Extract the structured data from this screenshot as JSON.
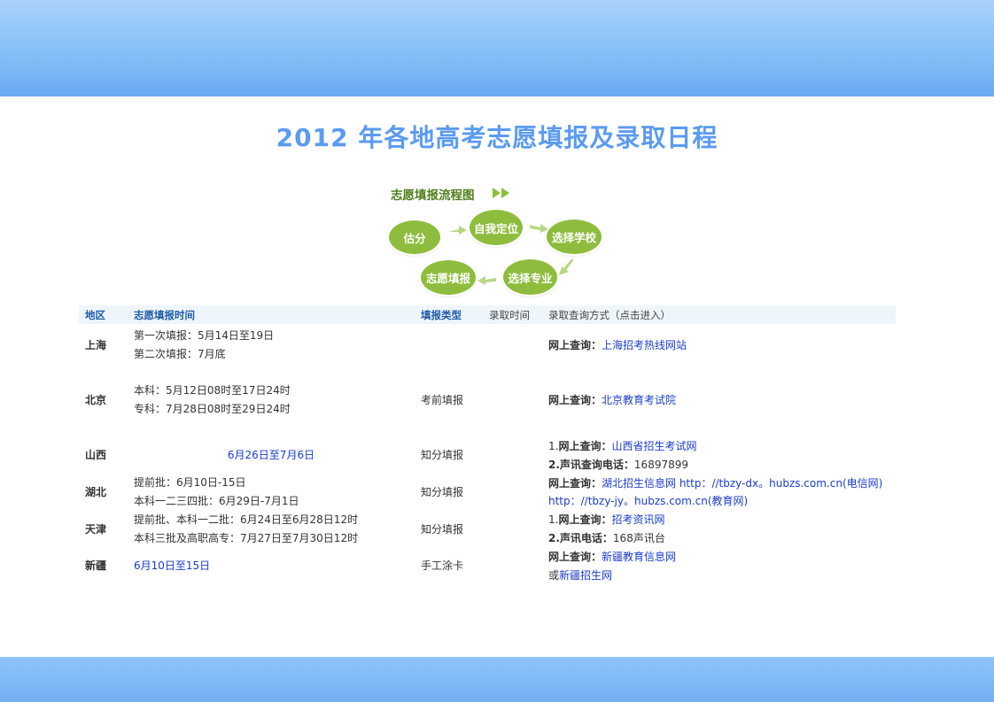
{
  "title": "2012 年各地高考志愿填报及录取日程",
  "flow": {
    "title": "志愿填报流程图",
    "steps": [
      "估分",
      "自我定位",
      "选择学校",
      "选择专业",
      "志愿填报"
    ]
  },
  "table": {
    "headers": [
      "地区",
      "志愿填报时间",
      "填报类型",
      "录取时间",
      "录取查询方式（点击进入）"
    ],
    "rows": [
      {
        "region": "上海",
        "time_lines": [
          "第一次填报：5月14日至19日",
          "第二次填报：7月底"
        ],
        "type": "",
        "query_label": "网上查询：",
        "query_link": "上海招考热线网站"
      },
      {
        "region": "北京",
        "time_lines": [
          "本科：5月12日08时至17日24时",
          "专科：7月28日08时至29日24时"
        ],
        "type": "考前填报",
        "query_label": "网上查询：",
        "query_link": "北京教育考试院"
      },
      {
        "region": "山西",
        "time_link": "6月26日至7月6日",
        "type": "知分填报",
        "q1_num": "1.",
        "q1_label": "网上查询：",
        "q1_link": "山西省招生考试网",
        "q2_label": "2.声讯查询电话：",
        "q2_value": "16897899"
      },
      {
        "region": "湖北",
        "time_lines": [
          "提前批：6月10日-15日",
          "本科一二三四批：6月29日-7月1日"
        ],
        "type": "知分填报",
        "q1_label": "网上查询：",
        "q1_link": "湖北招生信息网 http：//tbzy-dx。hubzs.com.cn(电信网)",
        "q2_link": "http：//tbzy-jy。hubzs.com.cn(教育网)"
      },
      {
        "region": "天津",
        "time_lines": [
          "提前批、本科一二批：6月24日至6月28日12时",
          "本科三批及高职高专：7月27日至7月30日12时"
        ],
        "type": "知分填报",
        "q1_num": "1.",
        "q1_label": "网上查询：",
        "q1_link": "招考资讯网",
        "q2_label": "2.声讯电话：",
        "q2_value": "168声讯台"
      },
      {
        "region": "新疆",
        "time_link": "6月10日至15日",
        "type": "手工涂卡",
        "q1_label": "网上查询：",
        "q1_link": "新疆教育信息网",
        "q2_prefix": "或",
        "q2_link": "新疆招生网"
      }
    ]
  },
  "colors": {
    "title": "#5b9bf0",
    "oval": "#8ebd3d",
    "flow_title": "#4f7f1c",
    "header_blue": "#1e5aa8",
    "link": "#1a3ccc",
    "band": "#83bdf7"
  }
}
